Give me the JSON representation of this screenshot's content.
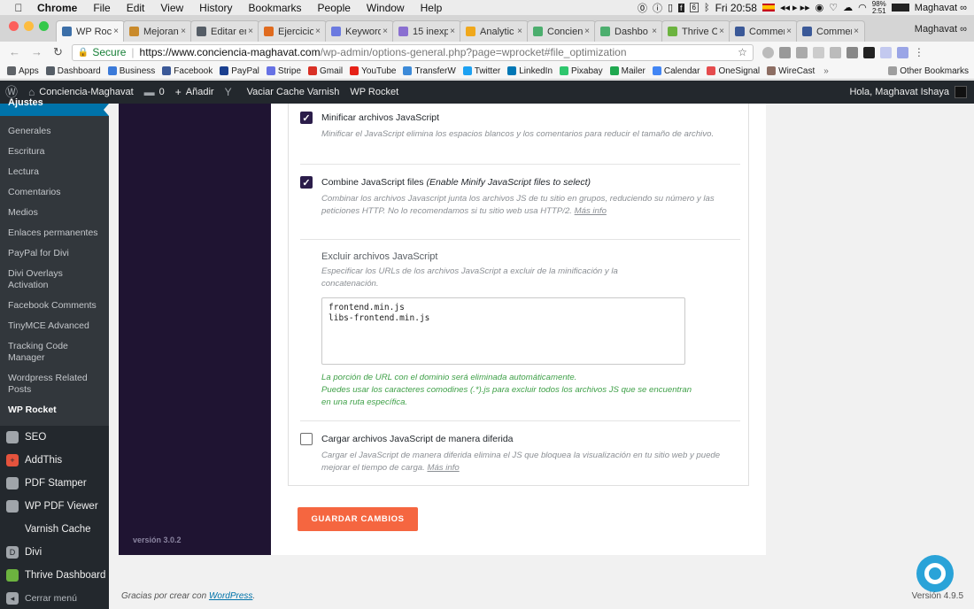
{
  "macos_menubar": {
    "app": "Chrome",
    "items": [
      "File",
      "Edit",
      "View",
      "History",
      "Bookmarks",
      "People",
      "Window",
      "Help"
    ],
    "calendar_day": "6",
    "clock": "Fri 20:58",
    "battery_pct": "98%",
    "battery_time": "2:51",
    "user": "Maghavat ∞"
  },
  "browser": {
    "tabs": [
      {
        "label": "WP Rock",
        "active": true,
        "color": "#3c6fa8"
      },
      {
        "label": "Mejoran",
        "active": false,
        "color": "#c98a2b"
      },
      {
        "label": "Editar er",
        "active": false,
        "color": "#555d66"
      },
      {
        "label": "Ejercicio",
        "active": false,
        "color": "#e06b1f"
      },
      {
        "label": "Keyword",
        "active": false,
        "color": "#6b7ae0"
      },
      {
        "label": "15 inexp",
        "active": false,
        "color": "#8a6fd1"
      },
      {
        "label": "Analytic",
        "active": false,
        "color": "#f0a81c"
      },
      {
        "label": "Concien",
        "active": false,
        "color": "#4cae6e"
      },
      {
        "label": "Dashbo",
        "active": false,
        "color": "#4cae6e"
      },
      {
        "label": "Thrive C",
        "active": false,
        "color": "#6cb33f"
      },
      {
        "label": "Commen",
        "active": false,
        "color": "#3b5998"
      },
      {
        "label": "Commen",
        "active": false,
        "color": "#3b5998"
      }
    ],
    "tab_close": "×",
    "url": {
      "secure_label": "Secure",
      "separator": "|",
      "domain": "https://www.conciencia-maghavat.com",
      "path": "/wp-admin/options-general.php?page=wprocket#file_optimization"
    },
    "bookmarks": [
      {
        "label": "Apps",
        "color": "#5f6368"
      },
      {
        "label": "Dashboard",
        "color": "#555d66"
      },
      {
        "label": "Business",
        "color": "#3b7ad9"
      },
      {
        "label": "Facebook",
        "color": "#3b5998"
      },
      {
        "label": "PayPal",
        "color": "#1a3f8f"
      },
      {
        "label": "Stripe",
        "color": "#6772e5"
      },
      {
        "label": "Gmail",
        "color": "#d93025"
      },
      {
        "label": "YouTube",
        "color": "#e62117"
      },
      {
        "label": "TransferW",
        "color": "#3c8ad8"
      },
      {
        "label": "Twitter",
        "color": "#1da1f2"
      },
      {
        "label": "LinkedIn",
        "color": "#0077b5"
      },
      {
        "label": "Pixabay",
        "color": "#2ec66d"
      },
      {
        "label": "Mailer",
        "color": "#1fa84f"
      },
      {
        "label": "Calendar",
        "color": "#4285f4"
      },
      {
        "label": "OneSignal",
        "color": "#e54b4d"
      },
      {
        "label": "WireCast",
        "color": "#8d6e63"
      }
    ],
    "bookmarks_overflow": "»",
    "other_bookmarks": "Other Bookmarks"
  },
  "admin_bar": {
    "site_name": "Conciencia-Maghavat",
    "comments_count": "0",
    "add_new": "Añadir",
    "varnish": "Vaciar Cache Varnish",
    "wp_rocket": "WP Rocket",
    "greeting": "Hola, Maghavat Ishaya"
  },
  "admin_menu": {
    "current_parent": "Ajustes",
    "submenu": [
      "Generales",
      "Escritura",
      "Lectura",
      "Comentarios",
      "Medios",
      "Enlaces permanentes",
      "PayPal for Divi",
      "Divi Overlays Activation",
      "Facebook Comments",
      "TinyMCE Advanced",
      "Tracking Code Manager",
      "Wordpress Related Posts",
      "WP Rocket"
    ],
    "submenu_active": "WP Rocket",
    "top_items": [
      {
        "label": "SEO",
        "icon": "yoast-icon",
        "color": "#a0a5aa",
        "glyph": ""
      },
      {
        "label": "AddThis",
        "icon": "addthis-icon",
        "color": "#e5533d",
        "glyph": "+"
      },
      {
        "label": "PDF Stamper",
        "icon": "stamp-icon",
        "color": "#a0a5aa",
        "glyph": ""
      },
      {
        "label": "WP PDF Viewer",
        "icon": "pdf-icon",
        "color": "#a0a5aa",
        "glyph": ""
      },
      {
        "label": "Varnish Cache",
        "icon": "varnish-icon",
        "color": "transparent",
        "glyph": ""
      },
      {
        "label": "Divi",
        "icon": "divi-icon",
        "color": "#a0a5aa",
        "glyph": "D"
      },
      {
        "label": "Thrive Dashboard",
        "icon": "thrive-icon",
        "color": "#6cb33f",
        "glyph": ""
      }
    ],
    "collapse": "Cerrar menú"
  },
  "wp_rocket": {
    "version": "versión 3.0.2",
    "options": {
      "minify_js": {
        "checked": true,
        "title": "Minificar archivos JavaScript",
        "desc": "Minificar el JavaScript elimina los espacios blancos y los comentarios para reducir el tamaño de archivo."
      },
      "combine_js": {
        "checked": true,
        "title": "Combine JavaScript files",
        "title_note": "(Enable Minify JavaScript files to select)",
        "desc": "Combinar los archivos Javascript junta los archivos JS de tu sitio en grupos, reduciendo su número y las peticiones HTTP. No lo recomendamos si tu sitio web usa HTTP/2.",
        "more": "Más info"
      },
      "exclude_js": {
        "title": "Excluir archivos JavaScript",
        "desc": "Especificar los URLs de los archivos JavaScript a excluir de la minificación y la concatenación.",
        "value": "frontend.min.js\nlibs-frontend.min.js",
        "help_1": "La porción de URL con el dominio será eliminada automáticamente.",
        "help_2": "Puedes usar los caracteres comodines (.*).js para excluir todos los archivos JS que se encuentran en una ruta específica."
      },
      "defer_js": {
        "checked": false,
        "title": "Cargar archivos JavaScript de manera diferida",
        "desc": "Cargar el JavaScript de manera diferida elimina el JS que bloquea la visualización en tu sitio web y puede mejorar el tiempo de carga.",
        "more": "Más info"
      }
    },
    "save_button": "GUARDAR CAMBIOS",
    "accent_color": "#f56640",
    "sidebar_color": "#1f1432"
  },
  "footer": {
    "thanks_prefix": "Gracias por crear con ",
    "thanks_link": "WordPress",
    "thanks_suffix": ".",
    "version": "Versión 4.9.5"
  }
}
